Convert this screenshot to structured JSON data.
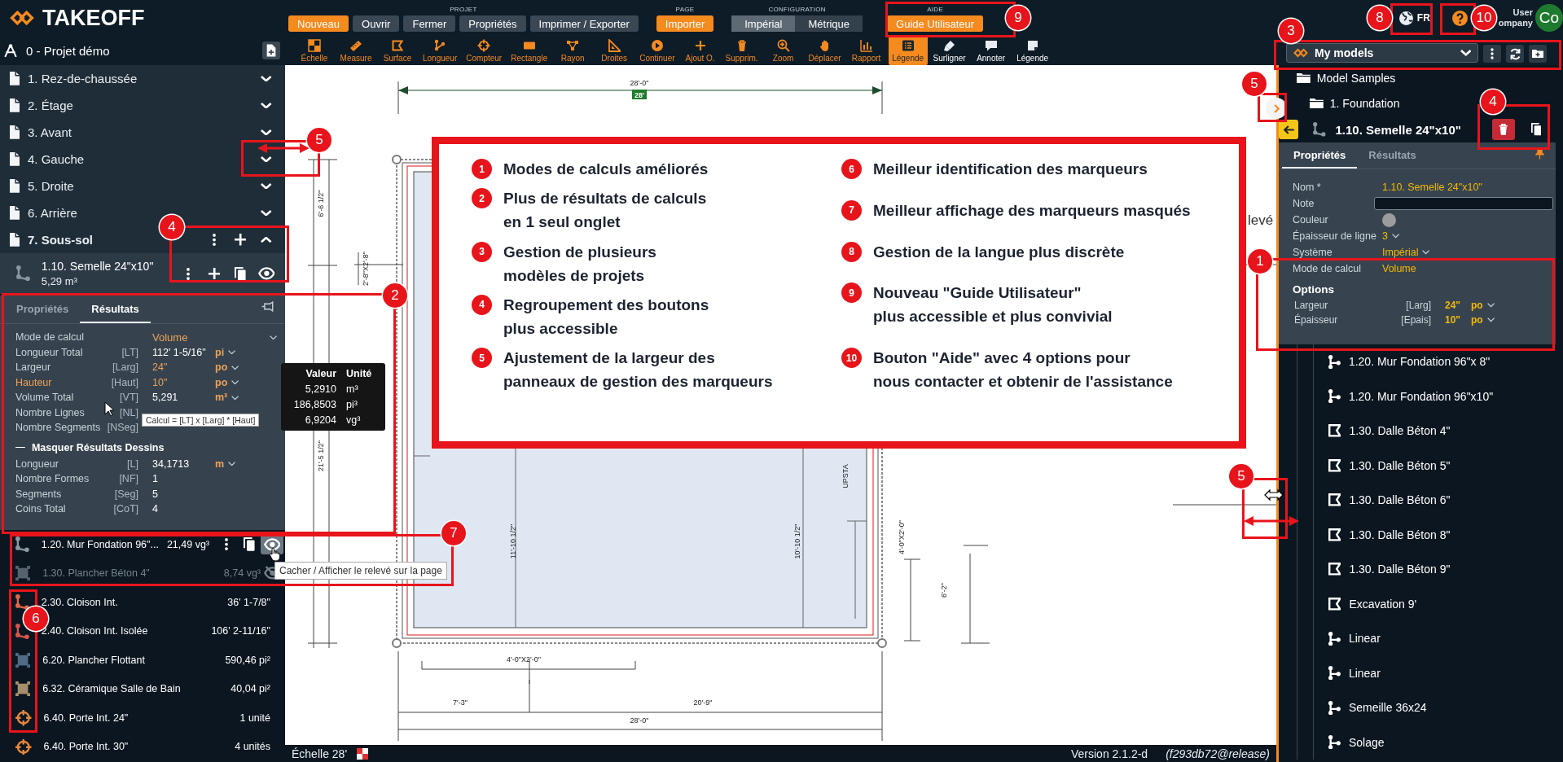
{
  "header": {
    "logo": "TAKEOFF",
    "project": "0 - Projet démo",
    "menu_groups": [
      {
        "label": "PROJET",
        "buttons": [
          {
            "label": "Nouveau",
            "kind": "primary"
          },
          {
            "label": "Ouvrir",
            "kind": "secondary"
          },
          {
            "label": "Fermer",
            "kind": "secondary"
          },
          {
            "label": "Propriétés",
            "kind": "secondary"
          },
          {
            "label": "Imprimer / Exporter",
            "kind": "secondary"
          }
        ]
      },
      {
        "label": "PAGE",
        "buttons": [
          {
            "label": "Importer",
            "kind": "primary"
          }
        ]
      },
      {
        "label": "CONFIGURATION",
        "buttons": [
          {
            "label": "Impérial",
            "kind": "toggle",
            "selected": true
          },
          {
            "label": "Métrique",
            "kind": "toggle",
            "selected": false
          }
        ]
      },
      {
        "label": "AIDE",
        "buttons": [
          {
            "label": "Guide Utilisateur",
            "kind": "primary"
          }
        ]
      }
    ],
    "language": "FR",
    "user": {
      "name": "User",
      "company": "ompany",
      "initials": "Co"
    },
    "toolbar": [
      {
        "label": "Échelle",
        "kind": "tool",
        "selected": false
      },
      {
        "label": "Measure",
        "kind": "tool",
        "selected": false
      },
      {
        "label": "Surface",
        "kind": "tool",
        "selected": false
      },
      {
        "label": "Longueur",
        "kind": "tool",
        "selected": false
      },
      {
        "label": "Compteur",
        "kind": "tool",
        "selected": false
      },
      {
        "label": "Rectangle",
        "kind": "tool",
        "selected": false
      },
      {
        "label": "Rayon",
        "kind": "tool",
        "selected": false
      },
      {
        "label": "Droites",
        "kind": "tool",
        "selected": false
      },
      {
        "label": "Continuer",
        "kind": "tool",
        "selected": false
      },
      {
        "label": "Ajout O.",
        "kind": "tool",
        "selected": false
      },
      {
        "label": "Supprim.",
        "kind": "tool",
        "selected": false
      },
      {
        "label": "Zoom",
        "kind": "tool",
        "selected": false
      },
      {
        "label": "Déplacer",
        "kind": "tool",
        "selected": false
      },
      {
        "label": "Rapport",
        "kind": "tool",
        "selected": false
      },
      {
        "label": "Légende",
        "kind": "tool",
        "selected": true
      },
      {
        "label": "Surligner",
        "kind": "markup",
        "selected": false
      },
      {
        "label": "Annoter",
        "kind": "markup",
        "selected": false
      },
      {
        "label": "Légende",
        "kind": "markup",
        "selected": false
      }
    ],
    "models": {
      "value": "My models"
    }
  },
  "left_panel": {
    "pages": [
      {
        "label": "1. Rez-de-chaussée",
        "expanded": false
      },
      {
        "label": "2. Étage",
        "expanded": false
      },
      {
        "label": "3. Avant",
        "expanded": false
      },
      {
        "label": "4. Gauche",
        "expanded": false
      },
      {
        "label": "5. Droite",
        "expanded": false
      },
      {
        "label": "6. Arrière",
        "expanded": false
      },
      {
        "label": "7. Sous-sol",
        "expanded": true
      }
    ],
    "selected_marker": {
      "name": "1.10. Semelle 24\"x10\"",
      "quantity": "5,29 m³"
    },
    "results_panel": {
      "tabs": [
        {
          "label": "Propriétés",
          "selected": false
        },
        {
          "label": "Résultats",
          "selected": true
        }
      ],
      "mode": {
        "label": "Mode de calcul",
        "value": "Volume"
      },
      "rows": [
        {
          "label": "Longueur Total",
          "code": "[LT]",
          "value": "112' 1-5/16\"",
          "unit": "pi",
          "editable": false,
          "highlighted": false
        },
        {
          "label": "Largeur",
          "code": "[Larg]",
          "value": "24\"",
          "unit": "po",
          "editable": true,
          "highlighted": false
        },
        {
          "label": "Hauteur",
          "code": "[Haut]",
          "value": "10\"",
          "unit": "po",
          "editable": true,
          "highlighted": true
        },
        {
          "label": "Volume Total",
          "code": "[VT]",
          "value": "5,291",
          "unit": "m³",
          "editable": false,
          "highlighted": false
        },
        {
          "label": "Nombre Lignes",
          "code": "[NL]",
          "highlighted": false
        },
        {
          "label": "Nombre Segments",
          "code": "[NSeg]",
          "highlighted": false
        }
      ],
      "section": "Masquer Résultats Dessins",
      "drawing_rows": [
        {
          "label": "Longueur",
          "code": "[L]",
          "value": "34,1713",
          "unit": "m"
        },
        {
          "label": "Nombre Formes",
          "code": "[NF]",
          "value": "1"
        },
        {
          "label": "Segments",
          "code": "[Seg]",
          "value": "5"
        },
        {
          "label": "Coins Total",
          "code": "[CoT]",
          "value": "4"
        }
      ]
    },
    "markers": [
      {
        "name": "1.20. Mur Fondation 96\"...",
        "quantity": "21,49 vg³",
        "kind": "linear",
        "color": "#8c99a3",
        "hovered": true,
        "hidden": false
      },
      {
        "name": "1.30. Plancher Béton 4\"",
        "quantity": "8,74 vg³",
        "kind": "area",
        "color": "#55636e",
        "hovered": false,
        "hidden": true
      },
      {
        "name": "2.30. Cloison Int.",
        "quantity": "36' 1-7/8\"",
        "kind": "linear",
        "color": "#e0674a",
        "hovered": false,
        "hidden": false
      },
      {
        "name": "2.40. Cloison Int. Isolée",
        "quantity": "106' 2-11/16\"",
        "kind": "linear",
        "color": "#d4574a",
        "hovered": false,
        "hidden": false
      },
      {
        "name": "6.20. Plancher Flottant",
        "quantity": "590,46 pi²",
        "kind": "area",
        "color": "#4f6b85",
        "hovered": false,
        "hidden": false
      },
      {
        "name": "6.32. Céramique Salle de Bain",
        "quantity": "40,04 pi²",
        "kind": "area",
        "color": "#a68f6c",
        "hovered": false,
        "hidden": false
      },
      {
        "name": "6.40. Porte Int. 24\"",
        "quantity": "1 unité",
        "kind": "count",
        "color": "#e8873a",
        "hovered": false,
        "hidden": false
      },
      {
        "name": "6.40. Porte Int. 30\"",
        "quantity": "4 unités",
        "kind": "count",
        "color": "#e8873a",
        "hovered": false,
        "hidden": false
      }
    ]
  },
  "canvas": {
    "scale_badge": "28'",
    "labels": [
      "28'-0\"",
      "6'-6 1/2\"",
      "2'-8\"X2'-8\"",
      "21'-5 1/2\"",
      "UPSTA",
      "11'-10 1/2\"",
      "10'-10 1/2\"",
      "4'-0\"X2'-0\"",
      "6'-2\"",
      "4'-0\"X2'-0\"",
      "7'-3\"",
      "20'-9\"",
      "28'-0\"",
      "levé"
    ]
  },
  "status_bar": {
    "scale": "Échelle 28'",
    "version": "Version 2.1.2-d",
    "build": "(f293db72@release)"
  },
  "right_panel": {
    "folders": [
      {
        "label": "Model Samples"
      },
      {
        "label": "1. Foundation"
      }
    ],
    "card": {
      "title": "1.10. Semelle 24\"x10\"",
      "tabs": [
        {
          "label": "Propriétés",
          "selected": true
        },
        {
          "label": "Résultats",
          "selected": false
        }
      ],
      "fields": [
        {
          "label": "Nom *",
          "kind": "text",
          "value": "1.10. Semelle 24\"x10\""
        },
        {
          "label": "Note",
          "kind": "input"
        },
        {
          "label": "Couleur",
          "kind": "color",
          "color": "#9c9c9c"
        },
        {
          "label": "Épaisseur de ligne",
          "kind": "select",
          "value": "3"
        },
        {
          "label": "Système",
          "kind": "select",
          "value": "Impérial"
        },
        {
          "label": "Mode de calcul",
          "kind": "text",
          "value": "Volume"
        }
      ],
      "options_title": "Options",
      "options": [
        {
          "label": "Largeur",
          "code": "[Larg]",
          "value": "24\"",
          "unit": "po"
        },
        {
          "label": "Épaisseur",
          "code": "[Epais]",
          "value": "10\"",
          "unit": "po"
        }
      ]
    },
    "items": [
      {
        "label": "1.20. Mur Fondation 96\"x 8\"",
        "kind": "linear"
      },
      {
        "label": "1.20. Mur Fondation 96\"x10\"",
        "kind": "linear"
      },
      {
        "label": "1.30. Dalle Béton 4\"",
        "kind": "area"
      },
      {
        "label": "1.30. Dalle Béton 5\"",
        "kind": "area"
      },
      {
        "label": "1.30. Dalle Béton 6\"",
        "kind": "area"
      },
      {
        "label": "1.30. Dalle Béton 8\"",
        "kind": "area"
      },
      {
        "label": "1.30. Dalle Béton 9\"",
        "kind": "area"
      },
      {
        "label": "Excavation 9'",
        "kind": "area"
      },
      {
        "label": "Linear",
        "kind": "linear"
      },
      {
        "label": "Linear",
        "kind": "linear"
      },
      {
        "label": "Semeille 36x24",
        "kind": "linear"
      },
      {
        "label": "Solage",
        "kind": "linear"
      }
    ]
  },
  "tooltips": {
    "values_table": {
      "columns": [
        "Valeur",
        "Unité"
      ],
      "rows": [
        [
          "5,2910",
          "m³"
        ],
        [
          "186,8503",
          "pi³"
        ],
        [
          "6,9204",
          "vg³"
        ]
      ]
    },
    "formula": "Calcul = [LT] x [Larg] * [Haut]",
    "hide_toggle": "Cacher / Afficher le relevé sur la page"
  },
  "callout": {
    "items": [
      {
        "number": "1",
        "text": "Modes de calculs améliorés"
      },
      {
        "number": "2",
        "text": "Plus de résultats de calculs\nen 1 seul onglet"
      },
      {
        "number": "3",
        "text": "Gestion de plusieurs\nmodèles de projets"
      },
      {
        "number": "4",
        "text": "Regroupement des boutons\nplus accessible"
      },
      {
        "number": "5",
        "text": "Ajustement de la largeur des\npanneaux de gestion des marqueurs"
      },
      {
        "number": "6",
        "text": "Meilleur identification des marqueurs"
      },
      {
        "number": "7",
        "text": "Meilleur affichage des marqueurs masqués"
      },
      {
        "number": "8",
        "text": "Gestion de la langue plus discrète"
      },
      {
        "number": "9",
        "text": "Nouveau \"Guide Utilisateur\"\nplus accessible et plus convivial"
      },
      {
        "number": "10",
        "text": "Bouton \"Aide\" avec 4 options pour\nnous contacter et obtenir de l'assistance"
      }
    ]
  },
  "annotations": [
    {
      "number": "9"
    },
    {
      "number": "8"
    },
    {
      "number": "10"
    },
    {
      "number": "3"
    },
    {
      "number": "5"
    },
    {
      "number": "5"
    },
    {
      "number": "4"
    },
    {
      "number": "4"
    },
    {
      "number": "1"
    },
    {
      "number": "2"
    },
    {
      "number": "5"
    },
    {
      "number": "7"
    },
    {
      "number": "6"
    }
  ]
}
